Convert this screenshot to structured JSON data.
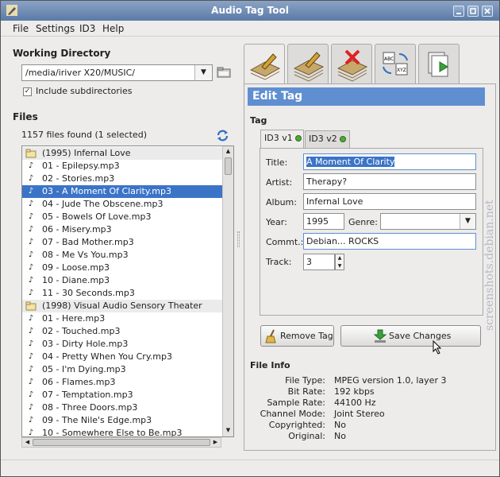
{
  "window": {
    "title": "Audio Tag Tool"
  },
  "menu": [
    "File",
    "Settings",
    "ID3",
    "Help"
  ],
  "left": {
    "working_directory_label": "Working Directory",
    "directory": "/media/iriver X20/MUSIC/",
    "include_subdirs_label": "Include subdirectories",
    "include_subdirs_checked": "✓",
    "files_label": "Files",
    "files_count": "1157 files found (1 selected)",
    "rows": [
      {
        "text": "(1995) Infernal Love",
        "type": "folder"
      },
      {
        "text": "01 - Epilepsy.mp3",
        "type": "file"
      },
      {
        "text": "02 - Stories.mp3",
        "type": "file"
      },
      {
        "text": "03 - A Moment Of Clarity.mp3",
        "type": "file",
        "selected": true
      },
      {
        "text": "04 - Jude The Obscene.mp3",
        "type": "file"
      },
      {
        "text": "05 - Bowels Of Love.mp3",
        "type": "file"
      },
      {
        "text": "06 - Misery.mp3",
        "type": "file"
      },
      {
        "text": "07 - Bad Mother.mp3",
        "type": "file"
      },
      {
        "text": "08 - Me Vs You.mp3",
        "type": "file"
      },
      {
        "text": "09 - Loose.mp3",
        "type": "file"
      },
      {
        "text": "10 - Diane.mp3",
        "type": "file"
      },
      {
        "text": "11 - 30 Seconds.mp3",
        "type": "file"
      },
      {
        "text": "(1998) Visual Audio Sensory Theater",
        "type": "folder"
      },
      {
        "text": "01 - Here.mp3",
        "type": "file"
      },
      {
        "text": "02 - Touched.mp3",
        "type": "file"
      },
      {
        "text": "03 - Dirty Hole.mp3",
        "type": "file"
      },
      {
        "text": "04 - Pretty When You Cry.mp3",
        "type": "file"
      },
      {
        "text": "05 - I'm Dying.mp3",
        "type": "file"
      },
      {
        "text": "06 - Flames.mp3",
        "type": "file"
      },
      {
        "text": "07 - Temptation.mp3",
        "type": "file"
      },
      {
        "text": "08 - Three Doors.mp3",
        "type": "file"
      },
      {
        "text": "09 - The Nile's Edge.mp3",
        "type": "file"
      },
      {
        "text": "10 - Somewhere Else to Be.mp3",
        "type": "file"
      }
    ]
  },
  "right": {
    "edit_tag_header": "Edit Tag",
    "tag_label": "Tag",
    "subtabs": [
      "ID3 v1",
      "ID3 v2"
    ],
    "fields": {
      "title_label": "Title:",
      "title": "A Moment Of Clarity",
      "artist_label": "Artist:",
      "artist": "Therapy?",
      "album_label": "Album:",
      "album": "Infernal Love",
      "year_label": "Year:",
      "year": "1995",
      "genre_label": "Genre:",
      "genre": "",
      "comment_label": "Commt.:",
      "comment": "Debian... ROCKS",
      "track_label": "Track:",
      "track": "3"
    },
    "remove_tag": "Remove Tag",
    "save_changes": "Save Changes",
    "file_info_label": "File Info",
    "file_info": [
      {
        "label": "File Type:",
        "value": "MPEG version 1.0, layer 3"
      },
      {
        "label": "Bit Rate:",
        "value": "192 kbps"
      },
      {
        "label": "Sample Rate:",
        "value": "44100 Hz"
      },
      {
        "label": "Channel Mode:",
        "value": "Joint Stereo"
      },
      {
        "label": "Copyrighted:",
        "value": "No"
      },
      {
        "label": "Original:",
        "value": "No"
      }
    ]
  },
  "watermark": "screenshots.debian.net"
}
